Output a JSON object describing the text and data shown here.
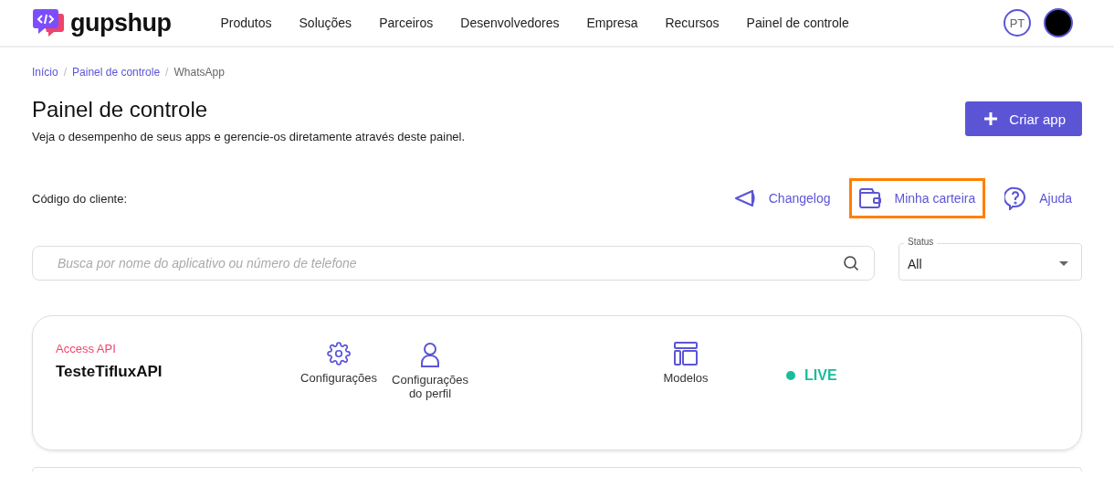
{
  "header": {
    "logo": "gupshup",
    "nav": [
      {
        "label": "Produtos"
      },
      {
        "label": "Soluções"
      },
      {
        "label": "Parceiros"
      },
      {
        "label": "Desenvolvedores"
      },
      {
        "label": "Empresa"
      },
      {
        "label": "Recursos"
      },
      {
        "label": "Painel de controle"
      }
    ],
    "language": "PT"
  },
  "breadcrumb": {
    "separator": "/",
    "items": [
      {
        "label": "Início",
        "link": true
      },
      {
        "label": "Painel de controle",
        "link": true
      },
      {
        "label": "WhatsApp",
        "link": false
      }
    ]
  },
  "page": {
    "title": "Painel de controle",
    "subtitle": "Veja o desempenho de seus apps e gerencie-os diretamente através deste painel.",
    "create_button": "Criar app"
  },
  "client_code_label": "Código do cliente:",
  "quick_links": [
    {
      "kind": "changelog",
      "label": "Changelog",
      "highlighted": false
    },
    {
      "kind": "wallet",
      "label": "Minha carteira",
      "highlighted": true
    },
    {
      "kind": "help",
      "label": "Ajuda",
      "highlighted": false
    }
  ],
  "search": {
    "placeholder": "Busca por nome do aplicativo ou número de telefone"
  },
  "status_filter": {
    "label": "Status",
    "value": "All"
  },
  "apps": [
    {
      "type": "Access API",
      "name": "TesteTifluxAPI",
      "actions": [
        {
          "kind": "settings",
          "label": "Configurações"
        },
        {
          "kind": "profile",
          "label": "Configurações do perfil"
        },
        {
          "kind": "templates",
          "label": "Modelos"
        }
      ],
      "status": "LIVE",
      "color": "#1abc9c"
    }
  ]
}
